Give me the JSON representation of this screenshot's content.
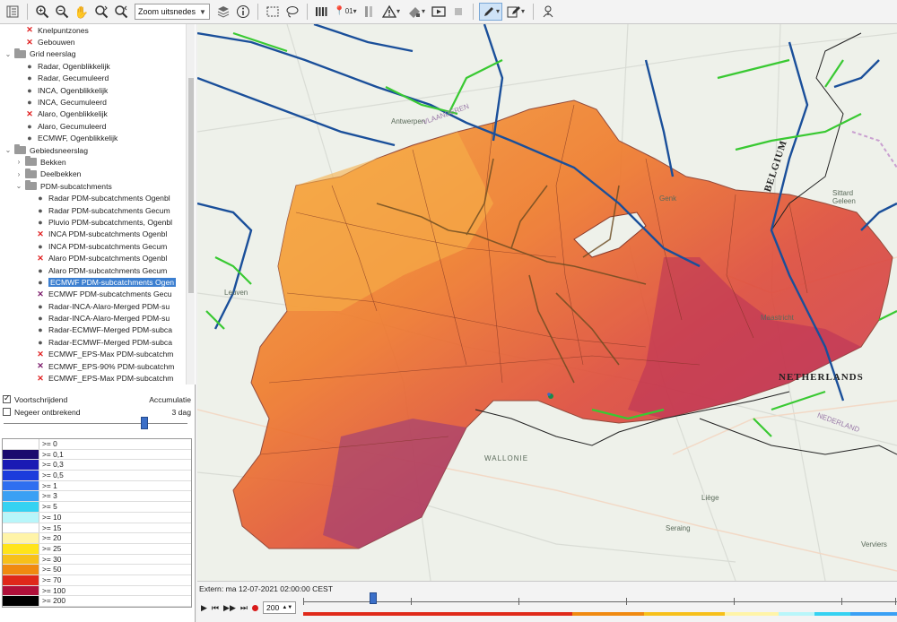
{
  "toolbar": {
    "zoom_select": "Zoom uitsnedes",
    "location_label": "01"
  },
  "tree": {
    "items": [
      {
        "label": "Knelpuntzones",
        "mark": "x",
        "indent": 2
      },
      {
        "label": "Gebouwen",
        "mark": "x",
        "indent": 2
      },
      {
        "label": "Grid neerslag",
        "mark": "folder-open",
        "indent": 0
      },
      {
        "label": "Radar, Ogenblikkelijk",
        "mark": "dot",
        "indent": 2
      },
      {
        "label": "Radar, Gecumuleerd",
        "mark": "dot",
        "indent": 2
      },
      {
        "label": "INCA, Ogenblikkelijk",
        "mark": "dot",
        "indent": 2
      },
      {
        "label": "INCA, Gecumuleerd",
        "mark": "dot",
        "indent": 2
      },
      {
        "label": "Alaro, Ogenblikkelijk",
        "mark": "x",
        "indent": 2
      },
      {
        "label": "Alaro, Gecumuleerd",
        "mark": "dot",
        "indent": 2
      },
      {
        "label": "ECMWF, Ogenblikkelijk",
        "mark": "dot",
        "indent": 2
      },
      {
        "label": "Gebiedsneerslag",
        "mark": "folder-open",
        "indent": 0
      },
      {
        "label": "Bekken",
        "mark": "folder-closed",
        "indent": 1
      },
      {
        "label": "Deelbekken",
        "mark": "folder-closed",
        "indent": 1
      },
      {
        "label": "PDM-subcatchments",
        "mark": "folder-open",
        "indent": 1
      },
      {
        "label": "Radar PDM-subcatchments Ogenbl",
        "mark": "dot",
        "indent": 3
      },
      {
        "label": "Radar PDM-subcatchments Gecum",
        "mark": "dot",
        "indent": 3
      },
      {
        "label": "Pluvio PDM-subcatchments, Ogenbl",
        "mark": "dot",
        "indent": 3
      },
      {
        "label": "INCA PDM-subcatchments Ogenbl",
        "mark": "x",
        "indent": 3
      },
      {
        "label": "INCA PDM-subcatchments Gecum",
        "mark": "dot",
        "indent": 3
      },
      {
        "label": "Alaro PDM-subcatchments Ogenbl",
        "mark": "x",
        "indent": 3
      },
      {
        "label": "Alaro PDM-subcatchments Gecum",
        "mark": "dot",
        "indent": 3
      },
      {
        "label": "ECMWF PDM-subcatchments Ogen",
        "mark": "dot",
        "indent": 3,
        "selected": true
      },
      {
        "label": "ECMWF PDM-subcatchments Gecu",
        "mark": "x-purple",
        "indent": 3
      },
      {
        "label": "Radar-INCA-Alaro-Merged PDM-su",
        "mark": "dot",
        "indent": 3
      },
      {
        "label": "Radar-INCA-Alaro-Merged PDM-su",
        "mark": "dot",
        "indent": 3
      },
      {
        "label": "Radar-ECMWF-Merged PDM-subca",
        "mark": "dot",
        "indent": 3
      },
      {
        "label": "Radar-ECMWF-Merged PDM-subca",
        "mark": "dot",
        "indent": 3
      },
      {
        "label": "ECMWF_EPS-Max PDM-subcatchm",
        "mark": "x",
        "indent": 3
      },
      {
        "label": "ECMWF_EPS-90% PDM-subcatchm",
        "mark": "x-purple",
        "indent": 3
      },
      {
        "label": "ECMWF_EPS-Max PDM-subcatchm",
        "mark": "x",
        "indent": 3
      }
    ]
  },
  "controls": {
    "voortschrijdend_label": "Voortschrijdend",
    "negeer_label": "Negeer ontbrekend",
    "accumulatie_label": "Accumulatie",
    "accumulatie_value": "3 dag"
  },
  "legend": [
    {
      "label": ">= 0",
      "color": "#ffffff"
    },
    {
      "label": ">= 0,1",
      "color": "#1a0a6e"
    },
    {
      "label": ">= 0,3",
      "color": "#1a1ab4"
    },
    {
      "label": ">= 0,5",
      "color": "#1c3cdc"
    },
    {
      "label": ">= 1",
      "color": "#2f6ff0"
    },
    {
      "label": ">= 3",
      "color": "#3aa0f4"
    },
    {
      "label": ">= 5",
      "color": "#35d2f2"
    },
    {
      "label": ">= 10",
      "color": "#b8f6fa"
    },
    {
      "label": ">= 15",
      "color": "#ffffff"
    },
    {
      "label": ">= 20",
      "color": "#fff4a8"
    },
    {
      "label": ">= 25",
      "color": "#ffe41a"
    },
    {
      "label": ">= 30",
      "color": "#f7c01a"
    },
    {
      "label": ">= 50",
      "color": "#f08a10"
    },
    {
      "label": ">= 70",
      "color": "#e0281a"
    },
    {
      "label": ">= 100",
      "color": "#b0103a"
    },
    {
      "label": ">= 200",
      "color": "#000000"
    }
  ],
  "map": {
    "labels": {
      "antwerpen": "Antwerpen",
      "genk": "Genk",
      "sittard": "Sittard Geleen",
      "maastricht": "Maastricht",
      "liege": "Liège",
      "seraing": "Seraing",
      "verviers": "Verviers",
      "leuven": "Leuven",
      "wallonie": "WALLONIE",
      "belgium": "BELGIUM",
      "netherlands": "NETHERLANDS",
      "nederland": "NEDERLAND",
      "vlaanderen": "VLAANDEREN"
    }
  },
  "bottom": {
    "extern_label": "Extern: ma 12-07-2021 02:00:00 CEST",
    "speed_value": "200"
  }
}
